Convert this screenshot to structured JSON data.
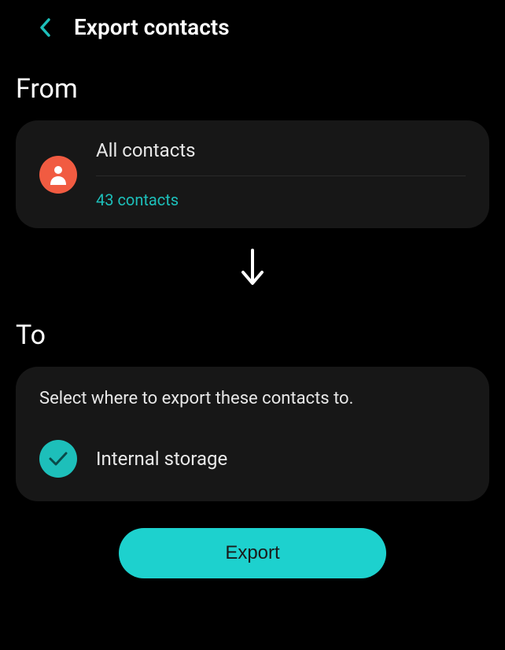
{
  "header": {
    "title": "Export contacts"
  },
  "from": {
    "label": "From",
    "source": "All contacts",
    "count": "43 contacts"
  },
  "to": {
    "label": "To",
    "instruction": "Select where to export these contacts to.",
    "option": "Internal storage"
  },
  "action": {
    "export_label": "Export"
  },
  "colors": {
    "accent_teal": "#1dd1ce",
    "accent_orange": "#f15b41",
    "card_bg": "#171717"
  }
}
